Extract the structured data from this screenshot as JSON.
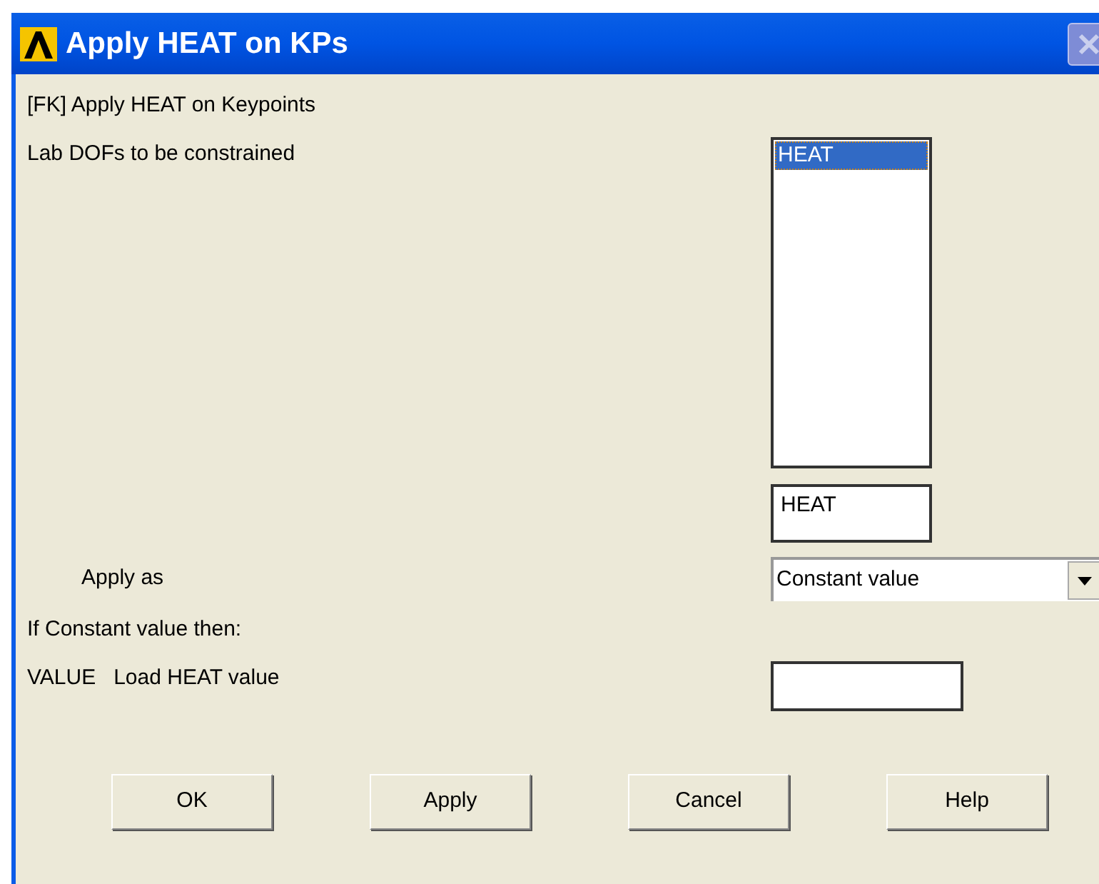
{
  "window": {
    "title": "Apply HEAT on KPs"
  },
  "heading": "[FK]  Apply HEAT on Keypoints",
  "dof": {
    "label": "Lab  DOFs to be constrained",
    "items": [
      {
        "label": "HEAT",
        "selected": true
      }
    ],
    "value": "HEAT"
  },
  "apply_as": {
    "label": "Apply as",
    "value": "Constant value"
  },
  "condition": "If Constant value then:",
  "value_field": {
    "label": "VALUE   Load HEAT value"
  },
  "buttons": [
    "OK",
    "Apply",
    "Cancel",
    "Help"
  ]
}
